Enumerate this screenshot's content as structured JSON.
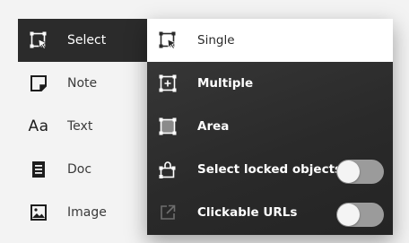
{
  "left_menu": {
    "items": [
      {
        "label": "Select",
        "icon": "select-icon",
        "selected": true
      },
      {
        "label": "Note",
        "icon": "note-icon"
      },
      {
        "label": "Text",
        "icon": "text-icon",
        "glyph": "Aa"
      },
      {
        "label": "Doc",
        "icon": "doc-icon"
      },
      {
        "label": "Image",
        "icon": "image-icon"
      }
    ]
  },
  "submenu": {
    "items": [
      {
        "label": "Single",
        "icon": "single-select-icon",
        "active": true
      },
      {
        "label": "Multiple",
        "icon": "multiple-select-icon"
      },
      {
        "label": "Area",
        "icon": "area-select-icon"
      },
      {
        "label": "Select locked objects",
        "icon": "lock-select-icon",
        "toggle": false
      },
      {
        "label": "Clickable URLs",
        "icon": "external-link-icon",
        "toggle": false
      }
    ]
  },
  "colors": {
    "background": "#f3f3f3",
    "menu_dark": "#2b2b2b",
    "toggle_off": "#9b9b9b"
  }
}
